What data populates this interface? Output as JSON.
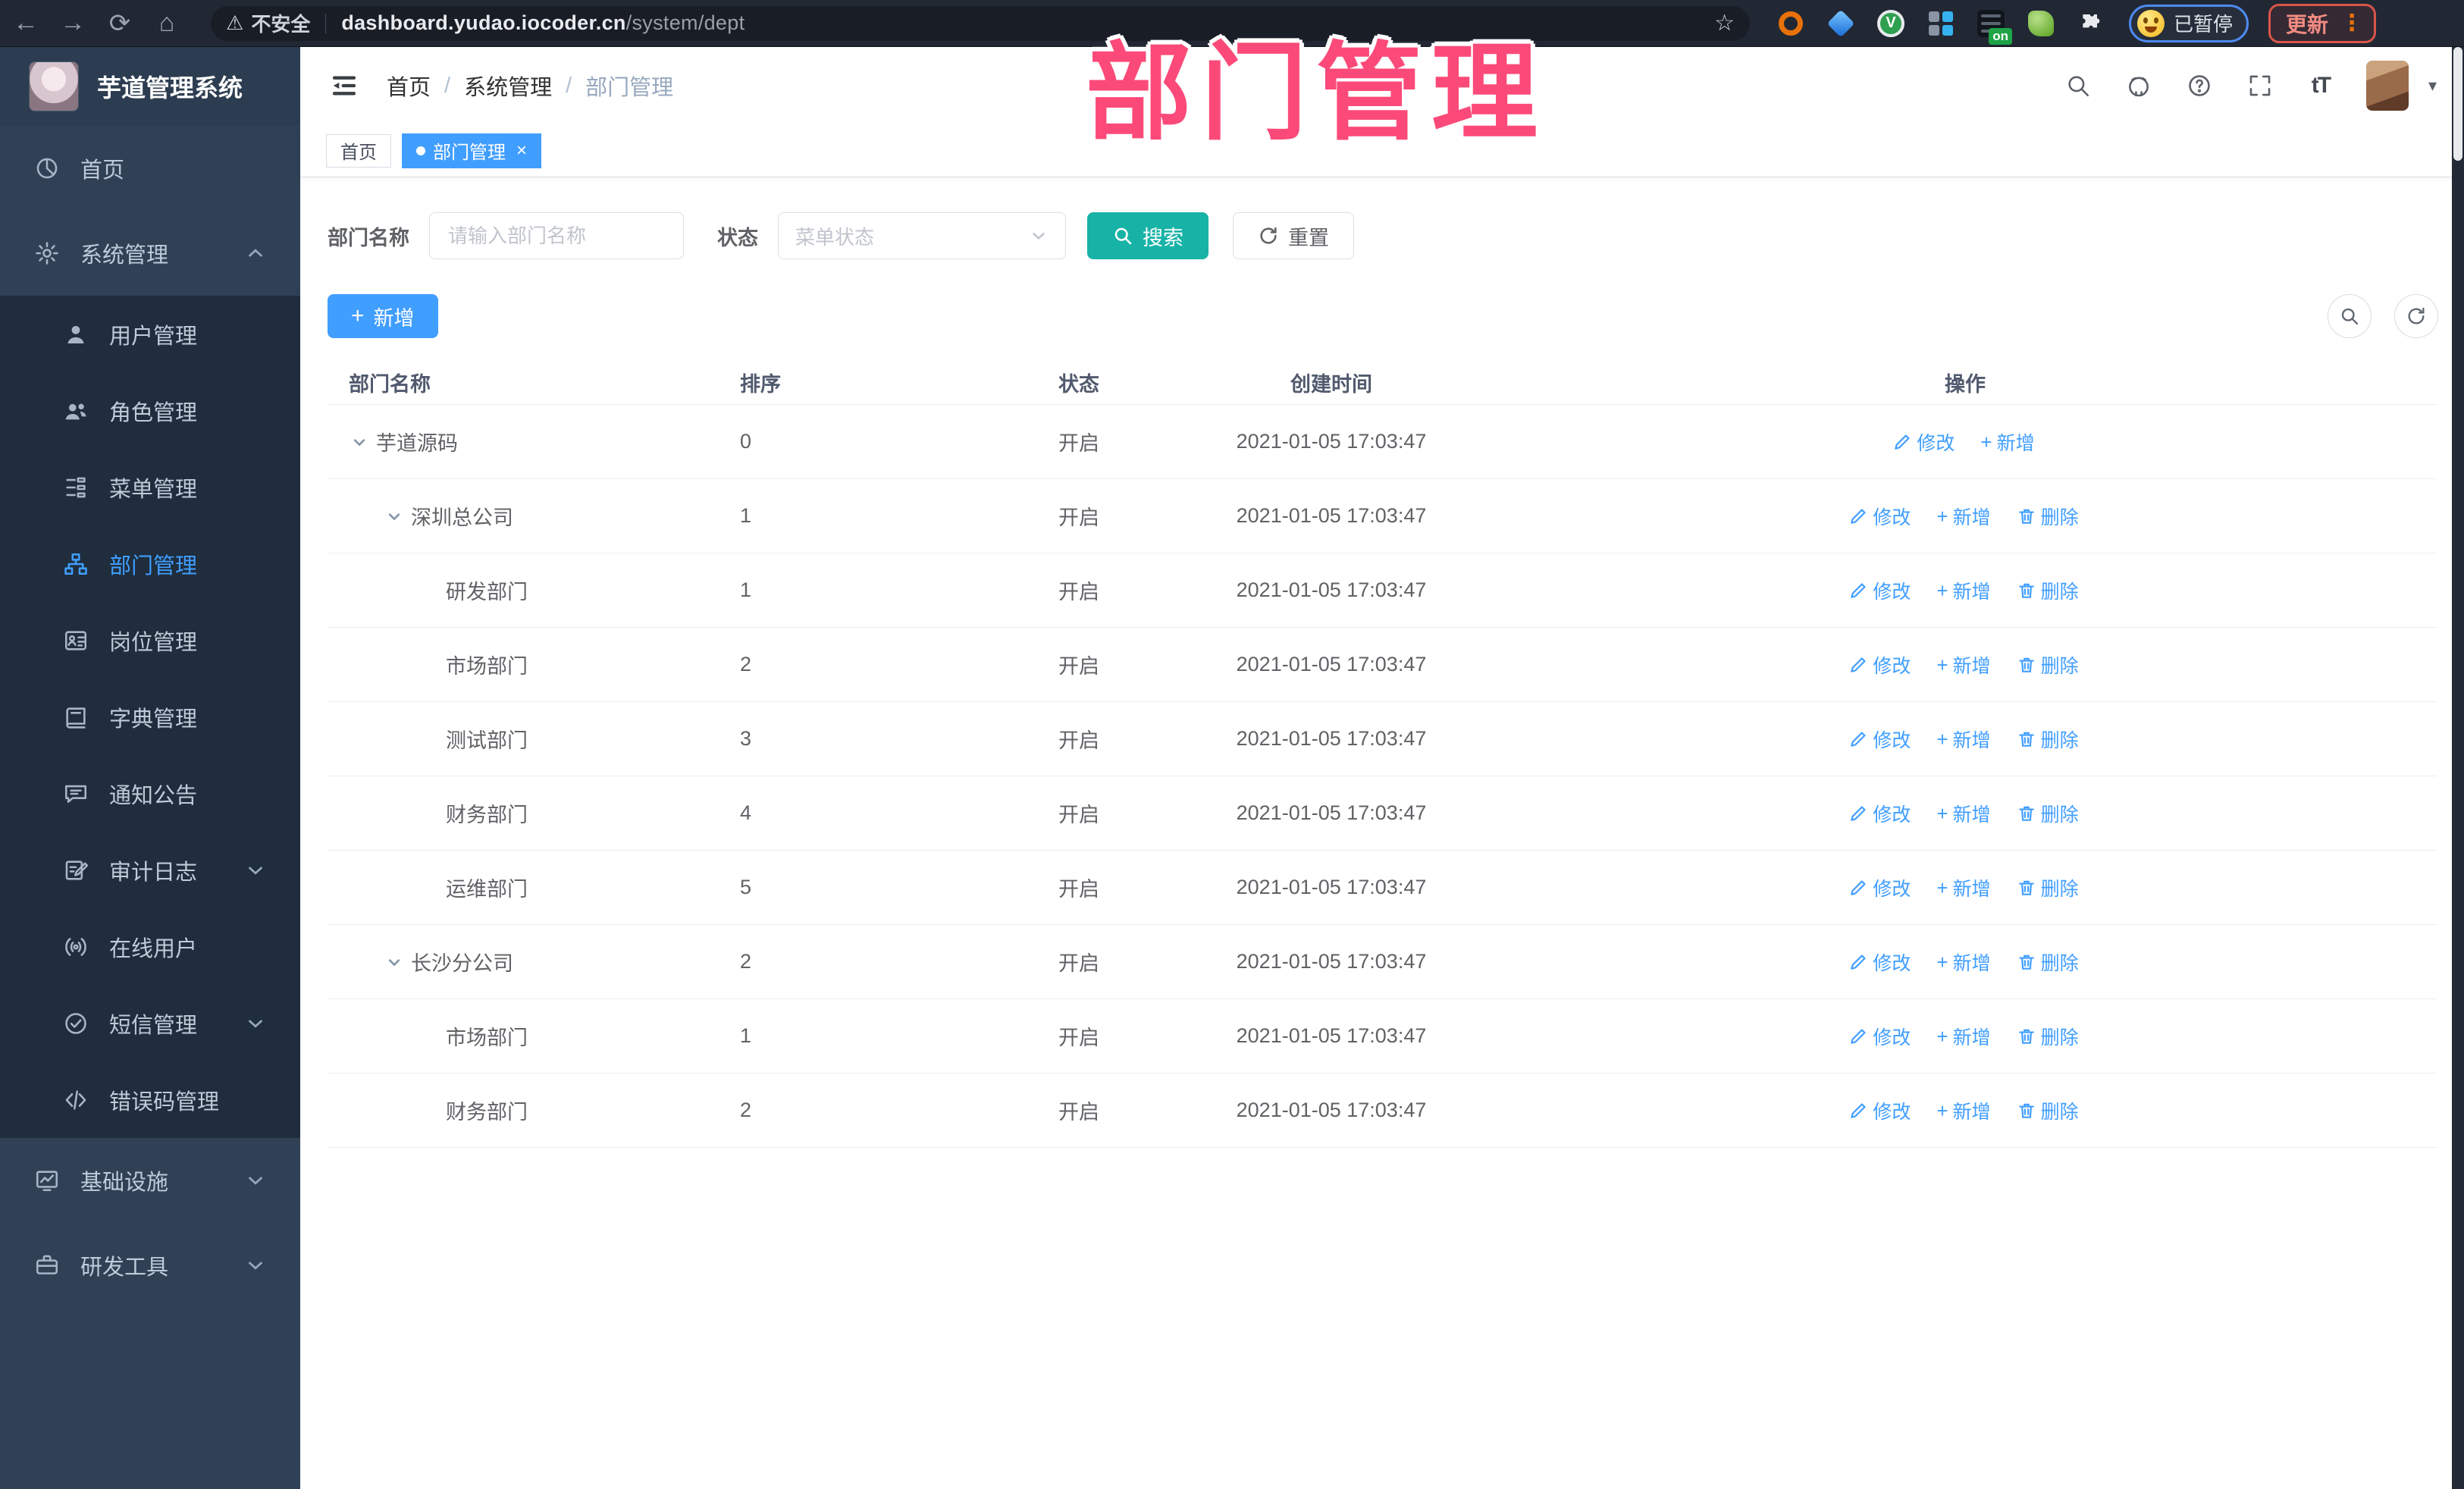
{
  "browser": {
    "security_label": "不安全",
    "url_host": "dashboard.yudao.iocoder.cn",
    "url_path": "/system/dept",
    "extension_badge": "on",
    "paused_label": "已暂停",
    "update_label": "更新"
  },
  "overlay": {
    "title": "部门管理",
    "color": "#fb4a79"
  },
  "sidebar": {
    "app_title": "芋道管理系统",
    "items": [
      {
        "label": "首页",
        "icon": "dashboard",
        "level": 0
      },
      {
        "label": "系统管理",
        "icon": "gear",
        "level": 0,
        "arrow": "up"
      },
      {
        "label": "用户管理",
        "icon": "user",
        "level": 1
      },
      {
        "label": "角色管理",
        "icon": "users",
        "level": 1
      },
      {
        "label": "菜单管理",
        "icon": "menutree",
        "level": 1
      },
      {
        "label": "部门管理",
        "icon": "orgtree",
        "level": 1,
        "active": true
      },
      {
        "label": "岗位管理",
        "icon": "badge",
        "level": 1
      },
      {
        "label": "字典管理",
        "icon": "book",
        "level": 1
      },
      {
        "label": "通知公告",
        "icon": "announce",
        "level": 1
      },
      {
        "label": "审计日志",
        "icon": "log",
        "level": 1,
        "arrow": "down"
      },
      {
        "label": "在线用户",
        "icon": "online",
        "level": 1
      },
      {
        "label": "短信管理",
        "icon": "sms",
        "level": 1,
        "arrow": "down"
      },
      {
        "label": "错误码管理",
        "icon": "code",
        "level": 1
      },
      {
        "label": "基础设施",
        "icon": "infra",
        "level": 0,
        "arrow": "down"
      },
      {
        "label": "研发工具",
        "icon": "tools",
        "level": 0,
        "arrow": "down"
      }
    ]
  },
  "header": {
    "breadcrumb": [
      "首页",
      "系统管理",
      "部门管理"
    ],
    "right_icons": [
      "search",
      "github",
      "help",
      "fullscreen",
      "fontsize"
    ],
    "fontsize_glyph": "tT"
  },
  "tags": [
    {
      "label": "首页",
      "active": false
    },
    {
      "label": "部门管理",
      "active": true,
      "closable": true
    }
  ],
  "filter": {
    "dept_label": "部门名称",
    "dept_placeholder": "请输入部门名称",
    "status_label": "状态",
    "status_placeholder": "菜单状态",
    "search_label": "搜索",
    "reset_label": "重置"
  },
  "toolbar": {
    "add_label": "新增"
  },
  "table": {
    "headers": [
      "部门名称",
      "排序",
      "状态",
      "创建时间",
      "操作"
    ],
    "action_labels": {
      "edit": "修改",
      "add": "新增",
      "delete": "删除"
    },
    "rows": [
      {
        "name": "芋道源码",
        "level": 0,
        "expand": true,
        "sort": "0",
        "status": "开启",
        "time": "2021-01-05 17:03:47",
        "actions": [
          "edit",
          "add"
        ]
      },
      {
        "name": "深圳总公司",
        "level": 1,
        "expand": true,
        "sort": "1",
        "status": "开启",
        "time": "2021-01-05 17:03:47",
        "actions": [
          "edit",
          "add",
          "delete"
        ]
      },
      {
        "name": "研发部门",
        "level": 2,
        "expand": false,
        "sort": "1",
        "status": "开启",
        "time": "2021-01-05 17:03:47",
        "actions": [
          "edit",
          "add",
          "delete"
        ]
      },
      {
        "name": "市场部门",
        "level": 2,
        "expand": false,
        "sort": "2",
        "status": "开启",
        "time": "2021-01-05 17:03:47",
        "actions": [
          "edit",
          "add",
          "delete"
        ]
      },
      {
        "name": "测试部门",
        "level": 2,
        "expand": false,
        "sort": "3",
        "status": "开启",
        "time": "2021-01-05 17:03:47",
        "actions": [
          "edit",
          "add",
          "delete"
        ]
      },
      {
        "name": "财务部门",
        "level": 2,
        "expand": false,
        "sort": "4",
        "status": "开启",
        "time": "2021-01-05 17:03:47",
        "actions": [
          "edit",
          "add",
          "delete"
        ]
      },
      {
        "name": "运维部门",
        "level": 2,
        "expand": false,
        "sort": "5",
        "status": "开启",
        "time": "2021-01-05 17:03:47",
        "actions": [
          "edit",
          "add",
          "delete"
        ]
      },
      {
        "name": "长沙分公司",
        "level": 1,
        "expand": true,
        "sort": "2",
        "status": "开启",
        "time": "2021-01-05 17:03:47",
        "actions": [
          "edit",
          "add",
          "delete"
        ]
      },
      {
        "name": "市场部门",
        "level": 2,
        "expand": false,
        "sort": "1",
        "status": "开启",
        "time": "2021-01-05 17:03:47",
        "actions": [
          "edit",
          "add",
          "delete"
        ]
      },
      {
        "name": "财务部门",
        "level": 2,
        "expand": false,
        "sort": "2",
        "status": "开启",
        "time": "2021-01-05 17:03:47",
        "actions": [
          "edit",
          "add",
          "delete"
        ]
      }
    ]
  },
  "colors": {
    "accent_blue": "#409eff",
    "search_teal": "#17b3a6",
    "overlay_pink": "#fb4a79",
    "sidebar_bg": "#304156",
    "submenu_bg": "#1f2d3d"
  }
}
